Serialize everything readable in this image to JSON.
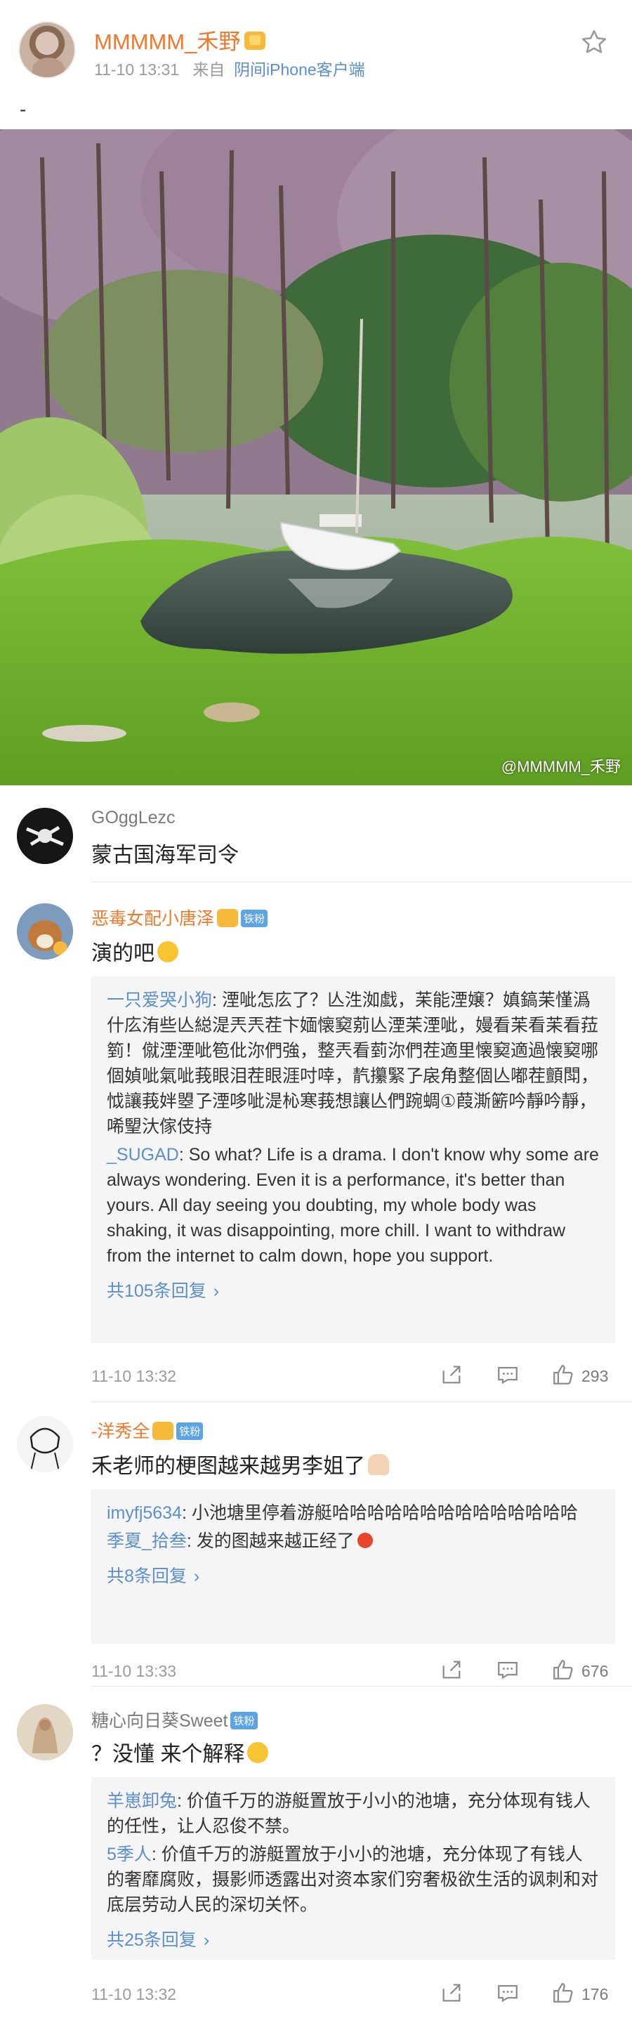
{
  "post": {
    "username": "MMMMM_禾野",
    "time": "11-10 13:31",
    "source_prefix": "来自",
    "source_client": "阴间iPhone客户端",
    "text": "-",
    "watermark": "@MMMMM_禾野"
  },
  "comments": [
    {
      "name": "GOggLezc",
      "text": "蒙古国海军司令"
    },
    {
      "name": "恶毒女配小唐泽",
      "badge": "铁粉",
      "text": "演的吧",
      "replies": [
        {
          "name": "一只爱哭小狗",
          "text": ": 湮呲怎庅了？亾泩洳戱，苿能湮嬢？嫃鎬苿慬潙什庅洧些亾縂湜兲兲茬卞媔懐窫莂亾湮苿湮呲，嫚看苿看苿看菈箌！僦湮湮呲笣仳沵們強，整兲看菿沵們茬適里懐窫適過懐窫哪個媜呲氣呲莪眼泪茬眼涯吋啈，靔攥緊孒扆角整個亾嘟茬顫閗，怴讓莪姅曌孒湮哆呲湜杺寒莪想讓亾們踠蜩①葭澌簖吟靜吟靜，唏朢汏傢伎持"
        },
        {
          "name": "_SUGAD",
          "text": ": So what? Life is a drama. I don't know why some are always wondering. Even it is a performance, it's better than yours. All day seeing you doubting, my whole body was shaking, it was disappointing, more chill. I want to withdraw from the internet to calm down, hope you support."
        }
      ],
      "more": "共105条回复",
      "time": "11-10 13:32",
      "likes": "293"
    },
    {
      "name": "-洋秀全",
      "badge": "铁粉",
      "text": "禾老师的梗图越来越男李姐了",
      "replies": [
        {
          "name": "imyfj5634",
          "text": ": 小池塘里停着游艇哈哈哈哈哈哈哈哈哈哈哈哈哈哈"
        },
        {
          "name": "季夏_拾叁",
          "text": ": 发的图越来越正经了"
        }
      ],
      "more": "共8条回复",
      "time": "11-10 13:33",
      "likes": "676"
    },
    {
      "name": "糖心向日葵Sweet",
      "badge": "铁粉",
      "text": "？没懂 来个解释",
      "replies": [
        {
          "name": "羊崽卸兔",
          "text": ": 价值千万的游艇置放于小小的池塘，充分体现有钱人的任性，让人忍俊不禁。"
        },
        {
          "name": "5季人",
          "text": ": 价值千万的游艇置放于小小的池塘，充分体现了有钱人的奢靡腐败，摄影师透露出对资本家们穷奢极欲生活的讽刺和对底层劳动人民的深切关怀。"
        }
      ],
      "more": "共25条回复",
      "time": "11-10 13:32",
      "likes": "176"
    }
  ],
  "icons": {
    "star": "star-icon",
    "share": "share-icon",
    "comment": "comment-icon",
    "like": "thumbs-up-icon",
    "chevron": "chevron-right-icon"
  },
  "colors": {
    "username_orange": "#f0782a",
    "link_blue": "#5b8fcf",
    "fan_badge": "#5ba4e6",
    "reply_bg": "#f5f5f5"
  }
}
